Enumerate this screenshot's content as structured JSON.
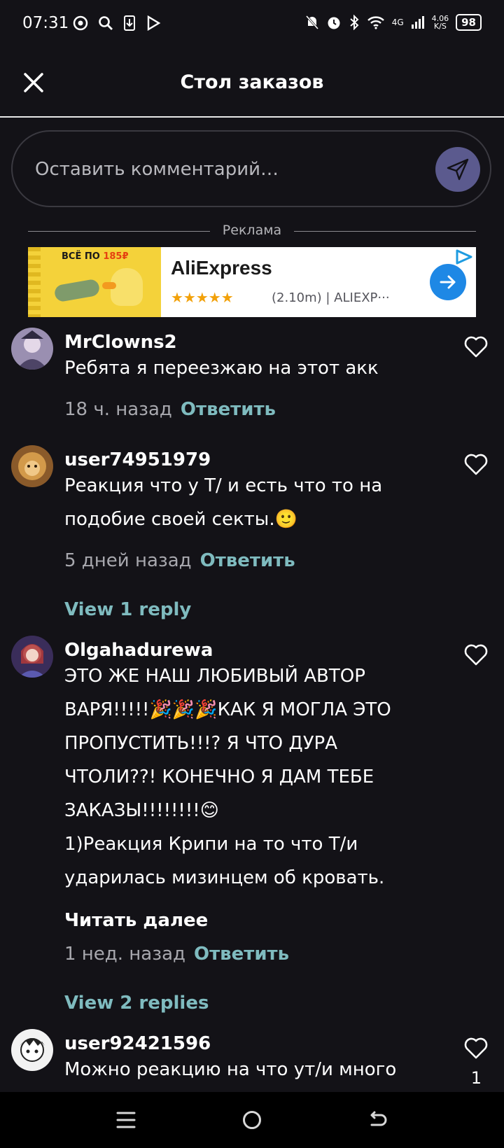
{
  "status_bar": {
    "time": "07:31",
    "network": "4G",
    "speed_value": "4.06",
    "speed_unit": "K/S",
    "battery": "98"
  },
  "header": {
    "title": "Стол заказов"
  },
  "comment_box": {
    "placeholder": "Оставить комментарий…"
  },
  "ad": {
    "label": "Реклама",
    "image_text": "ВСЁ ПО ",
    "image_price": "185₽",
    "brand": "AliExpress",
    "stars": "★★★★★",
    "meta": "(2.10m) | ALIEXP···"
  },
  "comments": [
    {
      "username": "MrClowns2",
      "lines": [
        "Ребята я переезжаю  на этот акк"
      ],
      "time": "18 ч. назад",
      "reply": "Ответить"
    },
    {
      "username": "user74951979",
      "lines": [
        "Реакция что у Т/ и есть что то на",
        "подобие своей секты.🙂"
      ],
      "time": "5 дней назад",
      "reply": "Ответить",
      "view_replies": "View 1 reply"
    },
    {
      "username": "Olgahadurewa",
      "lines": [
        "ЭТО ЖЕ НАШ ЛЮБИВЫЙ АВТОР",
        "ВАРЯ!!!!!🎉🎉🎉КАК Я МОГЛА ЭТО",
        "ПРОПУСТИТЬ!!!? Я ЧТО ДУРА",
        "ЧТОЛИ??! КОНЕЧНО Я ДАМ ТЕБЕ",
        "ЗАКАЗЫ!!!!!!!!😊",
        "1)Реакция Крипи на то что Т/и",
        "ударилась мизинцем об кровать."
      ],
      "read_more": "Читать далее",
      "time": "1 нед. назад",
      "reply": "Ответить",
      "view_replies": "View 2 replies"
    },
    {
      "username": "user92421596",
      "lines": [
        "Можно реакцию на что ут/и много"
      ],
      "likes": "1"
    }
  ],
  "colors": {
    "background": "#131217",
    "accent": "#7fbbbf",
    "send_button": "#5b5a8e"
  }
}
